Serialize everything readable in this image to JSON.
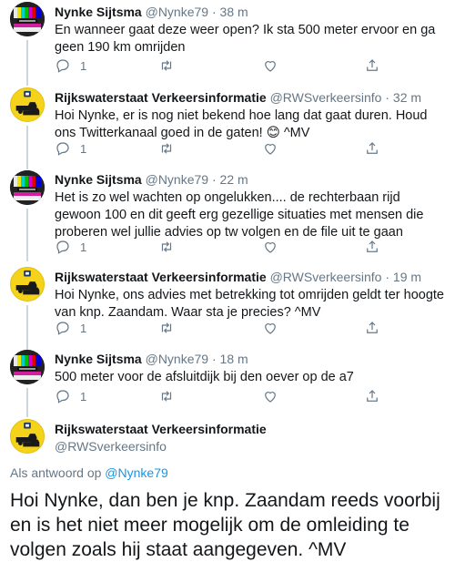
{
  "tweets": [
    {
      "name": "Nynke Sijtsma",
      "handle": "@Nynke79",
      "dot": "·",
      "time": "38 m",
      "text": "En wanneer gaat deze weer open? Ik sta 500 meter ervoor en ga geen 190 km omrijden",
      "reply_count": "1",
      "avatar": "offline-tv-testcard"
    },
    {
      "name": "Rijkswaterstaat Verkeersinformatie",
      "handle": "@RWSverkeersinfo",
      "dot": "·",
      "time": "32 m",
      "text": "Hoi Nynke, er is nog niet bekend hoe lang dat gaat duren. Houd ons Twitterkanaal goed in de gaten! 😊 ^MV",
      "reply_count": "1",
      "avatar": "rws-logo-cars"
    },
    {
      "name": "Nynke Sijtsma",
      "handle": "@Nynke79",
      "dot": "·",
      "time": "22 m",
      "text": "Het is zo wel wachten op ongelukken.... de rechterbaan rijd gewoon 100 en dit geeft erg gezellige situaties met mensen die proberen wel jullie advies op tw volgen en de file uit te gaan",
      "reply_count": "1",
      "avatar": "offline-tv-testcard"
    },
    {
      "name": "Rijkswaterstaat Verkeersinformatie",
      "handle": "@RWSverkeersinfo",
      "dot": "·",
      "time": "19 m",
      "text": "Hoi Nynke, ons advies met betrekking tot omrijden geldt ter hoogte van knp. Zaandam. Waar sta je precies? ^MV",
      "reply_count": "1",
      "avatar": "rws-logo-cars"
    },
    {
      "name": "Nynke Sijtsma",
      "handle": "@Nynke79",
      "dot": "·",
      "time": "18 m",
      "text": "500 meter voor de afsluitdijk bij den oever op de a7",
      "reply_count": "1",
      "avatar": "offline-tv-testcard"
    }
  ],
  "main_tweet": {
    "name": "Rijkswaterstaat Verkeersinformatie",
    "handle": "@RWSverkeersinfo",
    "reply_prefix": "Als antwoord op",
    "reply_mention": "@Nynke79",
    "text": "Hoi Nynke, dan ben je knp. Zaandam reeds voorbij en is het niet meer mogelijk om de omleiding te volgen zoals hij staat aangegeven. ^MV"
  },
  "colors": {
    "text": "#14171a",
    "secondary": "#657786",
    "link": "#1b95e0",
    "rws_yellow": "#f5d31a"
  },
  "icons": [
    "reply-icon",
    "retweet-icon",
    "like-icon",
    "share-icon"
  ]
}
